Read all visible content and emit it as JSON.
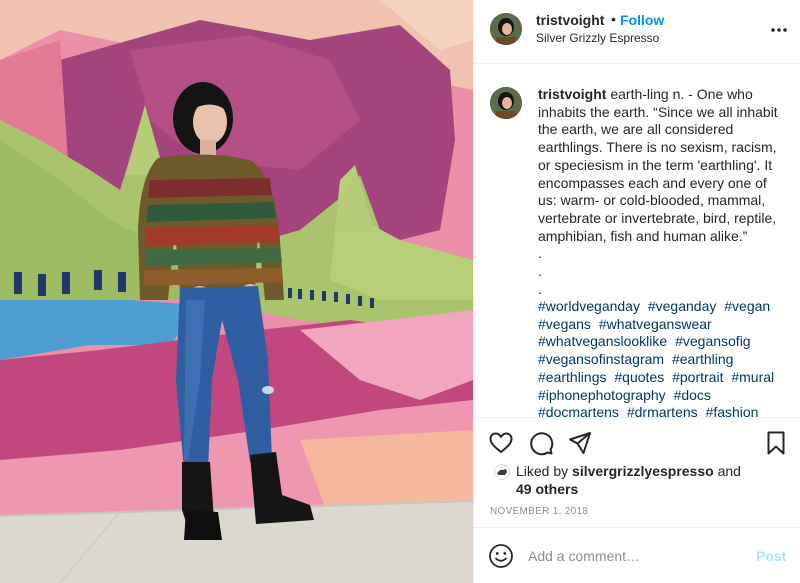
{
  "post": {
    "username": "tristvoight",
    "dot": "•",
    "follow_label": "Follow",
    "location": "Silver Grizzly Espresso",
    "more_icon": "more-horizontal-icon"
  },
  "caption": {
    "username": "tristvoight",
    "text": " earth-ling n. - One who inhabits the earth. “Since we all inhabit the earth, we are all considered earthlings. There is no sexism, racism, or speciesism in the term 'earthling'. It encompasses each and every one of us: warm- or cold-blooded, mammal, vertebrate or invertebrate, bird, reptile, amphibian, fish and human alike.”\n.\n.\n.",
    "hashtags": [
      "#worldveganday",
      "#veganday",
      "#vegan",
      "#vegans",
      "#whatveganswear",
      "#whatveganslooklike",
      "#vegansofig",
      "#vegansofinstagram",
      "#earthling",
      "#earthlings",
      "#quotes",
      "#portrait",
      "#mural",
      "#iphonephotography",
      "#docs",
      "#docmartens",
      "#drmartens",
      "#fashion"
    ]
  },
  "actions": {
    "like_icon": "heart-icon",
    "comment_icon": "comment-icon",
    "share_icon": "paper-plane-icon",
    "save_icon": "bookmark-icon"
  },
  "likes": {
    "prefix": "Liked by ",
    "user": "silvergrizzlyespresso",
    "and": " and",
    "others": "49 others"
  },
  "date": "NOVEMBER 1, 2018",
  "comment_bar": {
    "emoji_icon": "smiley-icon",
    "placeholder": "Add a comment…",
    "post_label": "Post"
  },
  "colors": {
    "link_blue": "#0095f6",
    "hashtag_blue": "#00376b",
    "post_disabled": "#b2dffc",
    "muted": "#8e8e8e"
  }
}
